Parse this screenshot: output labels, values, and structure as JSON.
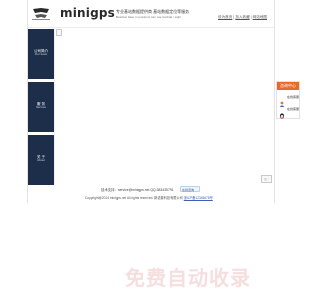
{
  "header": {
    "logo_text": "minigps",
    "tagline_main": "专业基站数据提供商 基站数据定位等服务",
    "tagline_sub": "Beststar base in positions can use lambda / sight",
    "top_links": [
      "设为首页",
      "加入收藏",
      "网站地图"
    ]
  },
  "sidebar": {
    "items": [
      {
        "title": "公司简介",
        "subtitle": "Our team"
      },
      {
        "title": "服  务",
        "subtitle": "Service"
      },
      {
        "title": "关  于",
        "subtitle": "About"
      }
    ]
  },
  "content": {
    "float_tool": "◫ ◦"
  },
  "footer": {
    "contact": "技术支持：service@minigps.net  QQ:383435791",
    "qq_chip": "在线咨询",
    "copyright": "Copyright@2014 minigps.net All rights reserved.  斯诺普科技有限公司",
    "icp_link": "浙ICP备12345678号"
  },
  "service_panel": {
    "title": "咨询中心",
    "items": [
      {
        "label": "在线客服",
        "icon": "person-icon"
      },
      {
        "label": "在线客服",
        "icon": "qq-icon"
      }
    ]
  },
  "watermark": {
    "text": "免费自动收录"
  },
  "colors": {
    "sidebar_bg": "#1d2e4a",
    "service_head": "#e86a26",
    "link": "#3b62b0",
    "watermark": "#f6dede"
  }
}
